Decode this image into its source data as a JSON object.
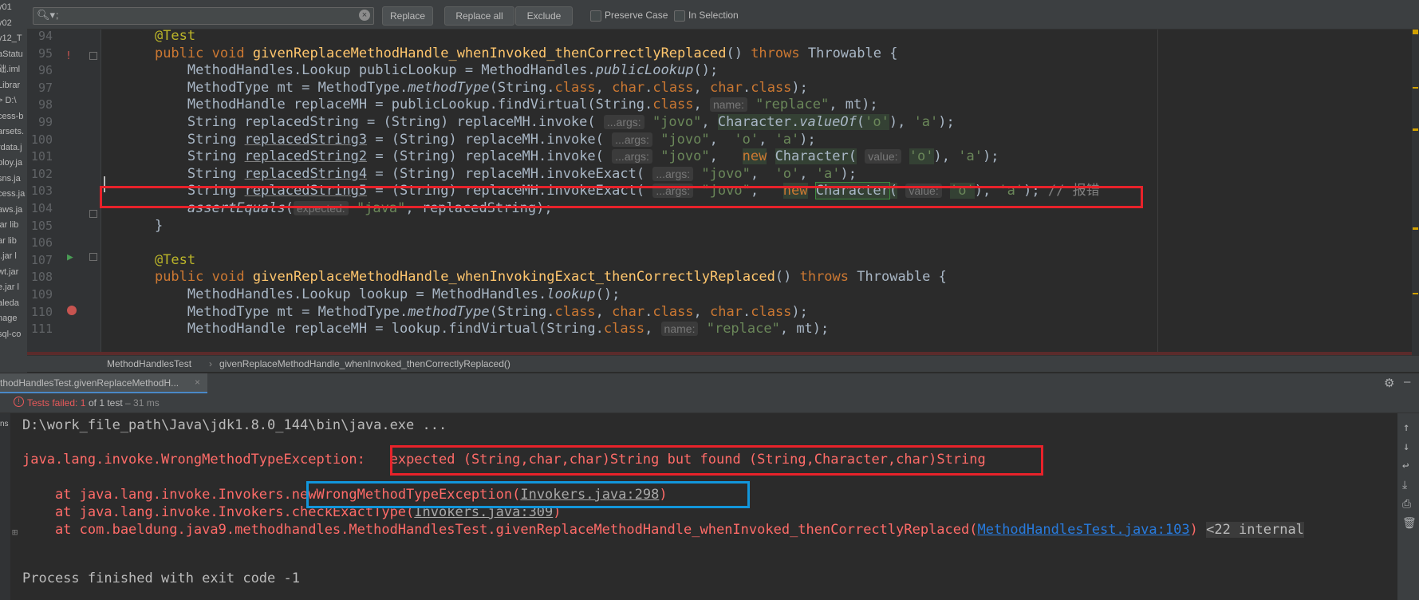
{
  "project_tree": {
    "items": [
      "y01",
      "y02",
      "y12_T",
      "aStatu",
      "础.iml",
      "Librar",
      "> D:\\",
      "cess-b",
      "arsets.",
      "rdata.j",
      "ploy.ja",
      "sns.ja",
      "cess.ja",
      "aws.ja",
      "jar lib",
      "ar lib",
      "t.jar l",
      "wt.jar",
      "e.jar l",
      "aleda",
      "nage",
      "sql-co"
    ]
  },
  "find_bar": {
    "search_value": ";",
    "replace_label": "Replace",
    "replace_all_label": "Replace all",
    "exclude_label": "Exclude",
    "preserve_case_label": "Preserve Case",
    "in_selection_label": "In Selection"
  },
  "editor": {
    "line_numbers": [
      "94",
      "95",
      "96",
      "97",
      "98",
      "99",
      "100",
      "101",
      "102",
      "103",
      "104",
      "105",
      "106",
      "107",
      "108",
      "109",
      "110",
      "111"
    ],
    "tok": {
      "annot": "@Test",
      "pub": "public",
      "void": "void",
      "m1": "givenReplaceMethodHandle_whenInvoked_thenCorrectlyReplaced",
      "parens": "()",
      "throws": "throws",
      "throwable": "Throwable {",
      "l96a": "MethodHandles.Lookup publicLookup = MethodHandles.",
      "publicLookup": "publicLookup",
      "end_call": "();",
      "l97a": "MethodType mt = MethodType.",
      "methodType": "methodType",
      "l97b": "(String.",
      "cls": "class",
      "comma_char": ", ",
      "char": "char",
      "dot": ".",
      "end_paren": ");",
      "l98a": "MethodHandle replaceMH = publicLookup.findVirtual(String.",
      "comma": ", ",
      "name_hint": "name:",
      "replace_str": "\"replace\"",
      "mt_end": ", mt);",
      "l99a": "String replacedString = (String) replaceMH.invoke(",
      "args_hint": "...args:",
      "jovo": "\"jovo\"",
      "character": "Character",
      "valueOf": "valueOf",
      "open": "(",
      "o_char": "'o'",
      "close_a": "), ",
      "a_char": "'a'",
      "str_kw": "String",
      "cast_invoke": " = (String) replaceMH.invoke(",
      "cast_invoke_exact": " = (String) replaceMH.invokeExact(",
      "rs3": "replacedString3",
      "rs2": "replacedString2",
      "rs4": "replacedString4",
      "rs5": "replacedString5",
      "new_kw": "new",
      "value_hint": "value:",
      "comment": "// 报错",
      "assertEquals": "assertEquals",
      "expected_hint": "expected:",
      "java_str": "\"java\"",
      "assert_end": ", replacedString);",
      "close_brace": "}",
      "m2": "givenReplaceMethodHandle_whenInvokingExact_thenCorrectlyReplaced",
      "l109a": "MethodHandles.Lookup lookup = MethodHandles.",
      "lookup": "lookup",
      "l111a": "MethodHandle replaceMH = lookup.findVirtual(String."
    }
  },
  "breadcrumb": {
    "class": "MethodHandlesTest",
    "method": "givenReplaceMethodHandle_whenInvoked_thenCorrectlyReplaced()"
  },
  "run_tab": {
    "label": "thodHandlesTest.givenReplaceMethodH...",
    "close": "×"
  },
  "status": {
    "failed_prefix": "Tests failed: ",
    "failed_count": "1",
    "of_total": " of 1 test",
    "duration": " – 31 ms"
  },
  "console": {
    "cmd": "D:\\work_file_path\\Java\\jdk1.8.0_144\\bin\\java.exe ...",
    "exc_class": "java.lang.invoke.WrongMethodTypeException: ",
    "exc_msg": "expected (String,char,char)String but found (String,Character,char)String",
    "at1a": "    at java.lang.invoke.Invokers.",
    "at1b": "newWrongMethodTypeException(",
    "at1link": "Invokers.java:298",
    "at1c": ")",
    "at2a": "    at java.lang.invoke.Invokers.checkExactType(",
    "at2link": "Invokers.java:309",
    "at2c": ")",
    "at3a": "    at com.baeldung.java9.methodhandles.MethodHandlesTest.givenReplaceMethodHandle_whenInvoked_thenCorrectlyReplaced(",
    "at3link": "MethodHandlesTest.java:103",
    "at3c": ")",
    "internal": "<22 internal",
    "finish": "Process finished with exit code -1"
  }
}
